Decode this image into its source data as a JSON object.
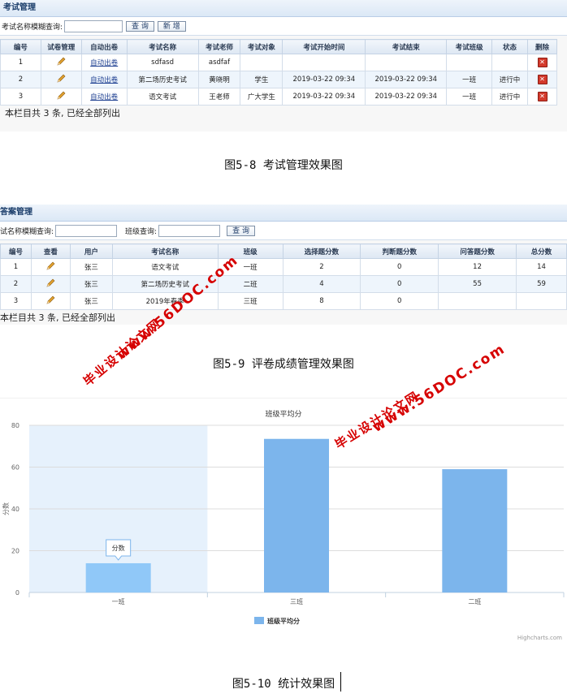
{
  "exam": {
    "title": "考试管理",
    "search_label": "考试名称模糊查询:",
    "query_button": "查 询",
    "add_button": "新 增",
    "headers": [
      "编号",
      "试卷管理",
      "自动出卷",
      "考试名称",
      "考试老师",
      "考试对象",
      "考试开始时间",
      "考试结束",
      "考试班级",
      "状态",
      "删除"
    ],
    "rows": [
      {
        "id": "1",
        "auto": "自动出卷",
        "name": "sdfasd",
        "teacher": "asdfaf",
        "target": "",
        "start": "",
        "end": "",
        "class": "",
        "status": ""
      },
      {
        "id": "2",
        "auto": "自动出卷",
        "name": "第二场历史考试",
        "teacher": "黄晓明",
        "target": "学生",
        "start": "2019-03-22 09:34",
        "end": "2019-03-22 09:34",
        "class": "一班",
        "status": "进行中"
      },
      {
        "id": "3",
        "auto": "自动出卷",
        "name": "语文考试",
        "teacher": "王老师",
        "target": "广大学生",
        "start": "2019-03-22 09:34",
        "end": "2019-03-22 09:34",
        "class": "一班",
        "status": "进行中"
      }
    ],
    "footer": "本栏目共 3 条, 已经全部列出",
    "caption": "图5-8 考试管理效果图"
  },
  "answers": {
    "title": "答案管理",
    "search_label": "试名称模糊查询:",
    "class_label": "班级查询:",
    "query_button": "查 询",
    "headers": [
      "编号",
      "查看",
      "用户",
      "考试名称",
      "班级",
      "选择题分数",
      "判断题分数",
      "问答题分数",
      "总分数"
    ],
    "rows": [
      {
        "id": "1",
        "user": "张三",
        "exam": "语文考试",
        "class": "一班",
        "choice": "2",
        "judge": "0",
        "qa": "12",
        "total": "14"
      },
      {
        "id": "2",
        "user": "张三",
        "exam": "第二场历史考试",
        "class": "二班",
        "choice": "4",
        "judge": "0",
        "qa": "55",
        "total": "59"
      },
      {
        "id": "3",
        "user": "张三",
        "exam": "2019年春季",
        "class": "三班",
        "choice": "8",
        "judge": "0",
        "qa": "",
        "total": ""
      }
    ],
    "footer": "本栏目共 3 条, 已经全部列出",
    "caption": "图5-9 评卷成绩管理效果图"
  },
  "chart_data": {
    "type": "bar",
    "title": "班级平均分",
    "ylabel": "分数",
    "categories": [
      "一班",
      "三班",
      "二班"
    ],
    "series": [
      {
        "name": "班级平均分",
        "values": [
          14,
          73.5,
          59
        ],
        "color": "#7cb5ec"
      }
    ],
    "ylim": [
      0,
      80
    ],
    "yticks": [
      0,
      20,
      40,
      60,
      80
    ],
    "tooltip": "分数",
    "highlighted_category": "一班",
    "legend_position": "bottom-center",
    "credits": "Highcharts.com",
    "caption": "图5-10 统计效果图"
  },
  "watermark": {
    "site": "www.56DOC.com",
    "name": "毕业设计论文网",
    "color": "#d60000"
  }
}
